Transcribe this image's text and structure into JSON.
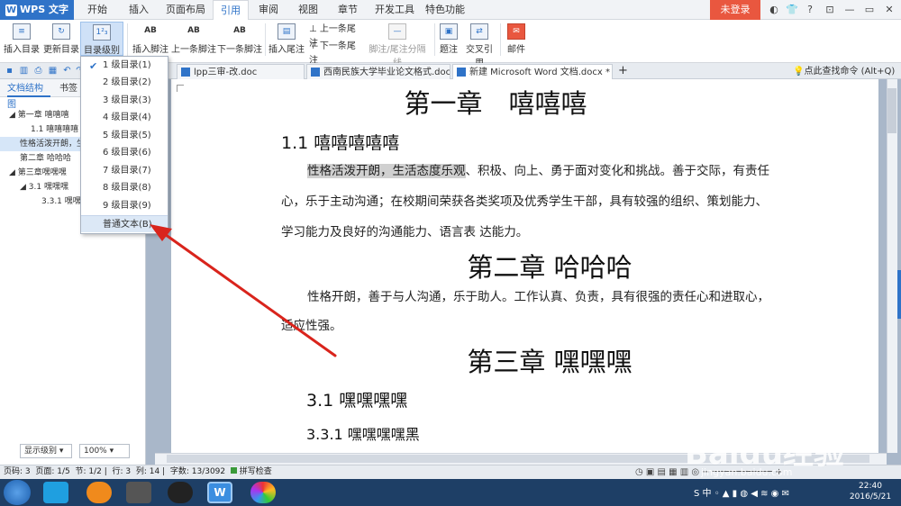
{
  "app": {
    "title": "WPS 文字",
    "login": "未登录"
  },
  "menu_tabs": [
    "开始",
    "插入",
    "页面布局",
    "引用",
    "审阅",
    "视图",
    "章节",
    "开发工具",
    "特色功能"
  ],
  "ribbon": {
    "insert_toc": "插入目录",
    "update_toc": "更新目录",
    "toc_level": "目录级别",
    "insert_footnote": "插入脚注",
    "prev_footnote": "上一条脚注",
    "next_footnote": "下一条脚注",
    "insert_endnote": "插入尾注",
    "prev_endnote": "上一条尾注",
    "next_endnote": "下一条尾注",
    "footnote_sep": "脚注/尾注分隔线",
    "caption": "题注",
    "cross_ref": "交叉引用",
    "mail": "邮件"
  },
  "doc_tabs": [
    "lpp三审-改.doc",
    "西南民族大学毕业论文格式.doc",
    "新建 Microsoft Word 文档.docx *"
  ],
  "help_search": "点此查找命令 (Alt+Q)",
  "left_panel": {
    "tabs": [
      "文档结构图",
      "书签"
    ],
    "nav": [
      "第一章 嘻嘻嘻",
      "1.1 嘻嘻嘻嘻",
      "性格活泼开朗，生",
      "第二章 哈哈哈",
      "第三章嘿嘿嘿",
      "3.1 嘿嘿嘿",
      "3.3.1 嘿嘿嘿"
    ],
    "show_level": "显示级别",
    "zoom": "100%"
  },
  "dropdown": {
    "items": [
      "1 级目录(1)",
      "2 级目录(2)",
      "3 级目录(3)",
      "4 级目录(4)",
      "5 级目录(5)",
      "6 级目录(6)",
      "7 级目录(7)",
      "8 级目录(8)",
      "9 级目录(9)",
      "普通文本(B)"
    ],
    "checked_index": 0
  },
  "document": {
    "h1_1": "第一章　嘻嘻嘻",
    "h2_1": "1.1  嘻嘻嘻嘻嘻",
    "p1_hl": "性格活泼开朗，生活态度乐观",
    "p1_rest": "、积极、向上、勇于面对变化和挑战。善于交际，有责任",
    "p1_line2": "心，乐于主动沟通；在校期间荣获各类奖项及优秀学生干部，具有较强的组织、策划能力、",
    "p1_line3": "学习能力及良好的沟通能力、语言表  达能力。",
    "h1_2": "第二章  哈哈哈",
    "p2_line1": "性格开朗，善于与人沟通，乐于助人。工作认真、负责，具有很强的责任心和进取心，",
    "p2_line2": "适应性强。",
    "h1_3": "第三章  嘿嘿嘿",
    "h2_3": "3.1  嘿嘿嘿嘿",
    "h3_3": "3.3.1  嘿嘿嘿嘿黑"
  },
  "status": {
    "page": "页码: 3",
    "pages": "页面: 1/5",
    "section": "节: 1/2",
    "row": "行: 3",
    "col": "列: 14",
    "words": "字数: 13/3092",
    "spell": "拼写检查"
  },
  "taskbar": {
    "time": "22:40",
    "date": "2016/5/21"
  },
  "watermark": {
    "logo": "Baidu经验",
    "url": "jingyan.baidu.com"
  },
  "colors": {
    "accent": "#2f73c8",
    "login": "#e9573f",
    "arrow": "#d9241c"
  }
}
